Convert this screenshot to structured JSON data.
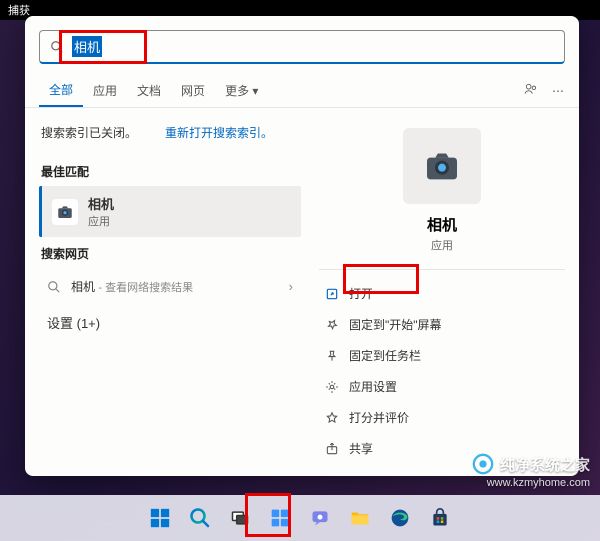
{
  "title_bar": "捕获",
  "search": {
    "query": "相机"
  },
  "tabs": {
    "items": [
      {
        "label": "全部",
        "active": true
      },
      {
        "label": "应用",
        "active": false
      },
      {
        "label": "文档",
        "active": false
      },
      {
        "label": "网页",
        "active": false
      },
      {
        "label": "更多 ▾",
        "active": false
      }
    ]
  },
  "index": {
    "off_msg": "搜索索引已关闭。",
    "reopen_link": "重新打开搜索索引。"
  },
  "sections": {
    "best_match": "最佳匹配",
    "search_web": "搜索网页",
    "settings": "设置 (1+)"
  },
  "best_match": {
    "title": "相机",
    "subtitle": "应用"
  },
  "web_result": {
    "term": "相机",
    "subtitle": "- 查看网络搜索结果"
  },
  "detail": {
    "name": "相机",
    "type": "应用",
    "actions": [
      {
        "icon": "open",
        "label": "打开"
      },
      {
        "icon": "pin-start",
        "label": "固定到\"开始\"屏幕"
      },
      {
        "icon": "pin-taskbar",
        "label": "固定到任务栏"
      },
      {
        "icon": "settings",
        "label": "应用设置"
      },
      {
        "icon": "rate",
        "label": "打分并评价"
      },
      {
        "icon": "share",
        "label": "共享"
      }
    ]
  },
  "watermark": {
    "brand": "纯净系统之家",
    "url": "www.kzmyhome.com"
  }
}
